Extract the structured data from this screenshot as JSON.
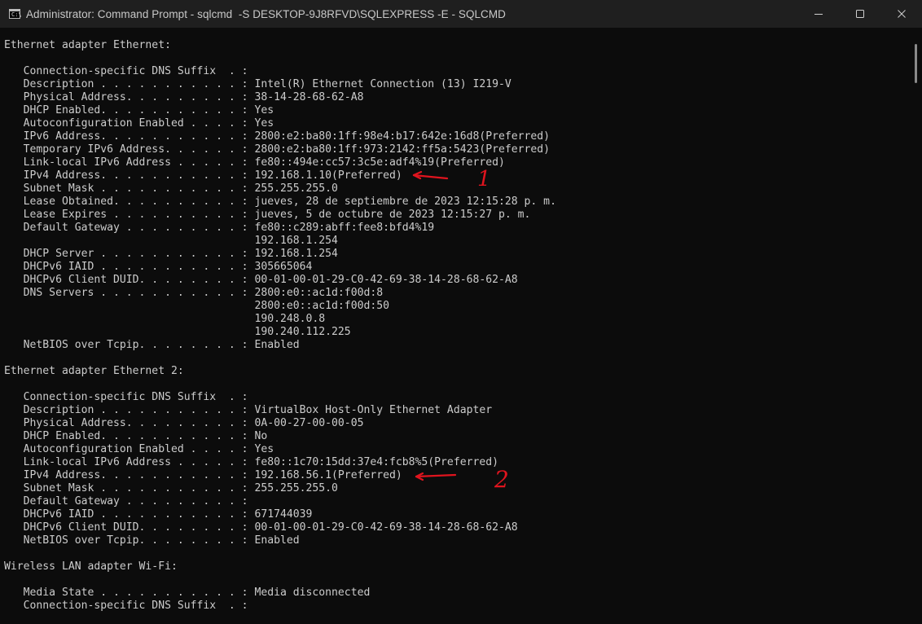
{
  "window": {
    "title": "Administrator: Command Prompt - sqlcmd  -S DESKTOP-9J8RFVD\\SQLEXPRESS -E - SQLCMD",
    "icon_name": "cmd-icon",
    "icon_text": "C:\\",
    "controls": [
      "minimize-icon",
      "maximize-icon",
      "close-icon"
    ]
  },
  "console": {
    "lines": [
      "Ethernet adapter Ethernet:",
      "",
      "   Connection-specific DNS Suffix  . :",
      "   Description . . . . . . . . . . . : Intel(R) Ethernet Connection (13) I219-V",
      "   Physical Address. . . . . . . . . : 38-14-28-68-62-A8",
      "   DHCP Enabled. . . . . . . . . . . : Yes",
      "   Autoconfiguration Enabled . . . . : Yes",
      "   IPv6 Address. . . . . . . . . . . : 2800:e2:ba80:1ff:98e4:b17:642e:16d8(Preferred)",
      "   Temporary IPv6 Address. . . . . . : 2800:e2:ba80:1ff:973:2142:ff5a:5423(Preferred)",
      "   Link-local IPv6 Address . . . . . : fe80::494e:cc57:3c5e:adf4%19(Preferred)",
      "   IPv4 Address. . . . . . . . . . . : 192.168.1.10(Preferred)",
      "   Subnet Mask . . . . . . . . . . . : 255.255.255.0",
      "   Lease Obtained. . . . . . . . . . : jueves, 28 de septiembre de 2023 12:15:28 p. m.",
      "   Lease Expires . . . . . . . . . . : jueves, 5 de octubre de 2023 12:15:27 p. m.",
      "   Default Gateway . . . . . . . . . : fe80::c289:abff:fee8:bfd4%19",
      "                                       192.168.1.254",
      "   DHCP Server . . . . . . . . . . . : 192.168.1.254",
      "   DHCPv6 IAID . . . . . . . . . . . : 305665064",
      "   DHCPv6 Client DUID. . . . . . . . : 00-01-00-01-29-C0-42-69-38-14-28-68-62-A8",
      "   DNS Servers . . . . . . . . . . . : 2800:e0::ac1d:f00d:8",
      "                                       2800:e0::ac1d:f00d:50",
      "                                       190.248.0.8",
      "                                       190.240.112.225",
      "   NetBIOS over Tcpip. . . . . . . . : Enabled",
      "",
      "Ethernet adapter Ethernet 2:",
      "",
      "   Connection-specific DNS Suffix  . :",
      "   Description . . . . . . . . . . . : VirtualBox Host-Only Ethernet Adapter",
      "   Physical Address. . . . . . . . . : 0A-00-27-00-00-05",
      "   DHCP Enabled. . . . . . . . . . . : No",
      "   Autoconfiguration Enabled . . . . : Yes",
      "   Link-local IPv6 Address . . . . . : fe80::1c70:15dd:37e4:fcb8%5(Preferred)",
      "   IPv4 Address. . . . . . . . . . . : 192.168.56.1(Preferred)",
      "   Subnet Mask . . . . . . . . . . . : 255.255.255.0",
      "   Default Gateway . . . . . . . . . :",
      "   DHCPv6 IAID . . . . . . . . . . . : 671744039",
      "   DHCPv6 Client DUID. . . . . . . . : 00-01-00-01-29-C0-42-69-38-14-28-68-62-A8",
      "   NetBIOS over Tcpip. . . . . . . . : Enabled",
      "",
      "Wireless LAN adapter Wi-Fi:",
      "",
      "   Media State . . . . . . . . . . . : Media disconnected",
      "   Connection-specific DNS Suffix  . :"
    ]
  },
  "annotations": {
    "color": "#e0141e",
    "marks": [
      {
        "name": "arrow-annotation-1",
        "label": "1"
      },
      {
        "name": "arrow-annotation-2",
        "label": "2"
      }
    ]
  },
  "colors": {
    "background": "#0c0c0c",
    "titlebar": "#1f1f1f",
    "text": "#cccccc"
  }
}
